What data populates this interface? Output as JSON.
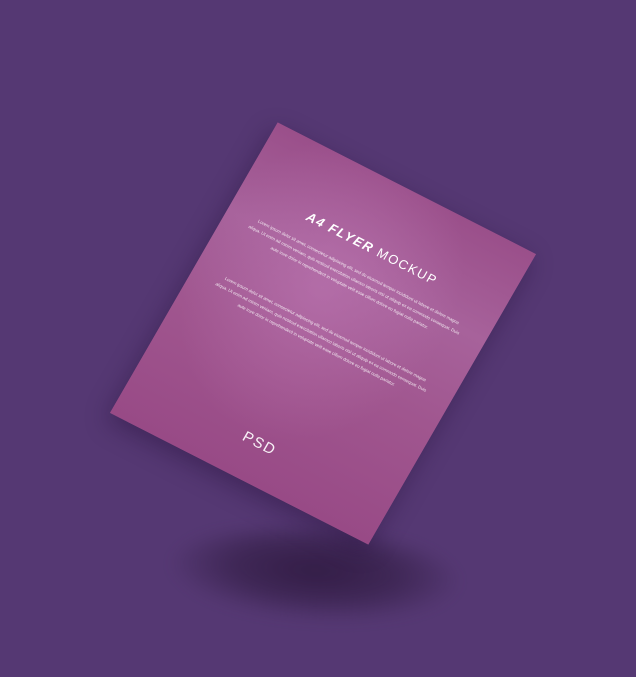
{
  "flyer": {
    "title_bold": "A4 FLYER",
    "title_light": "MOCKUP",
    "paragraphs": [
      "Lorem ipsum dolor sit amet, consectetur adipiscing elit, sed do eiusmod tempor incididunt ut labore et dolore magna aliqua. Ut enim ad minim veniam, quis nostrud exercitation ullamco laboris nisi ut aliquip ex ea commodo consequat. Duis aute irure dolor in reprehenderit in voluptate velit esse cillum dolore eu fugiat nulla pariatur.",
      "Lorem ipsum dolor sit amet, consectetur adipiscing elit, sed do eiusmod tempor incididunt ut labore et dolore magna aliqua. Ut enim ad minim veniam, quis nostrud exercitation ullamco laboris nisi ut aliquip ex ea commodo consequat. Duis aute irure dolor in reprehenderit in voluptate velit esse cillum dolore eu fugiat nulla pariatur."
    ],
    "footer": "PSD"
  },
  "colors": {
    "background": "#553873",
    "flyer": "#9a4f8a",
    "text": "#ffffff"
  }
}
